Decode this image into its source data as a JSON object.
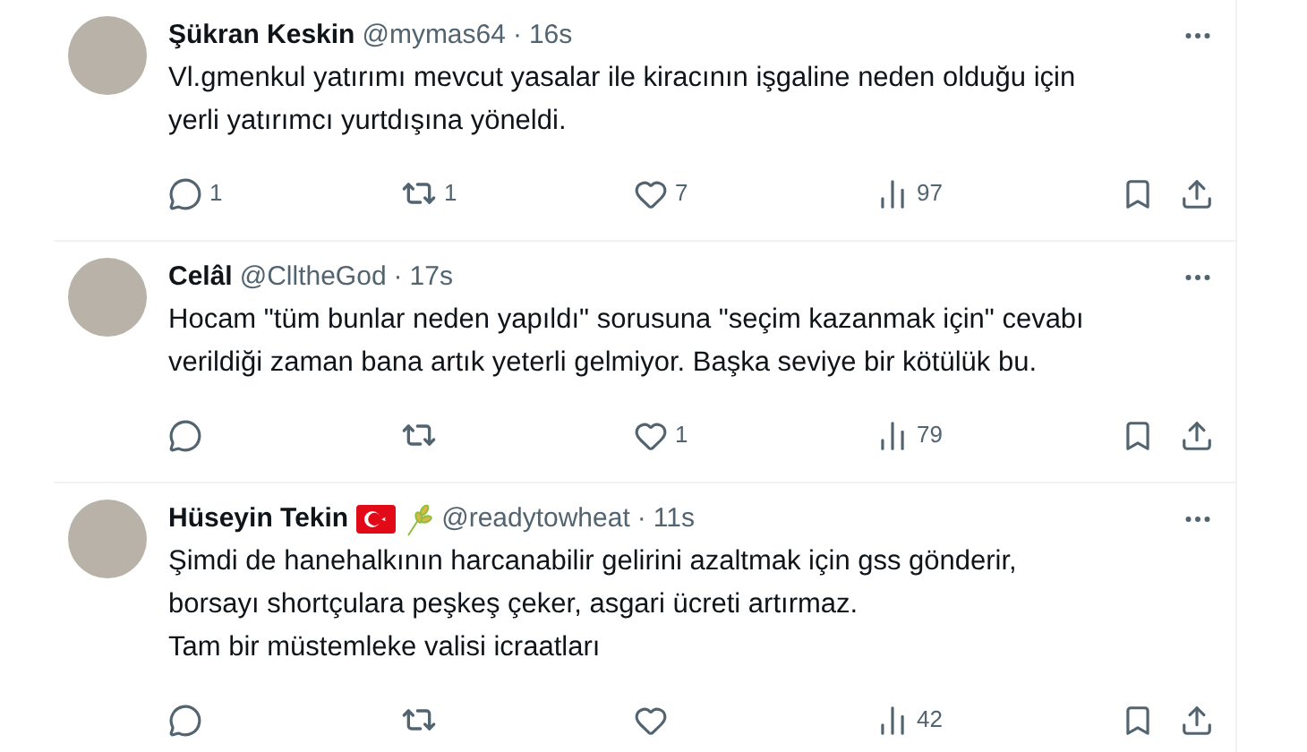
{
  "tweets": [
    {
      "name": "Şükran Keskin",
      "handle": "@mymas64",
      "separator": "·",
      "time": "16s",
      "text_lines": [
        "Vl.gmenkul yatırımı mevcut yasalar ile kiracının işgaline neden olduğu için",
        "yerli yatırımcı yurtdışına yöneldi."
      ],
      "replies": "1",
      "reposts": "1",
      "likes": "7",
      "views": "97"
    },
    {
      "name": "Celâl",
      "handle": "@ClltheGod",
      "separator": "·",
      "time": "17s",
      "text_lines": [
        "Hocam \"tüm bunlar neden yapıldı\" sorusuna \"seçim kazanmak için\" cevabı",
        "verildiği zaman bana artık yeterli gelmiyor. Başka seviye bir kötülük bu."
      ],
      "likes": "1",
      "views": "79"
    },
    {
      "name": "Hüseyin Tekin",
      "handle": "@readytowheat",
      "separator": "·",
      "time": "11s",
      "text_lines": [
        "Şimdi de hanehalkının harcanabilir gelirini azaltmak için gss gönderir,",
        "borsayı shortçulara peşkeş çeker, asgari ücreti artırmaz.",
        "Tam bir müstemleke valisi icraatları"
      ],
      "badges": [
        {
          "kind": "flag"
        },
        {
          "kind": "wheat"
        }
      ],
      "views": "42"
    }
  ]
}
